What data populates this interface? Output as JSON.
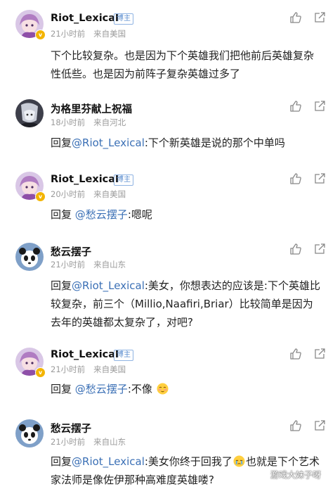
{
  "comments": [
    {
      "username": "Riot_Lexical",
      "badge": "博主",
      "time": "21小时前",
      "location": "来自美国",
      "text": "下个比较复杂。也是因为下个英雄我们把他前后英雄复杂性低些。也是因为前阵子复杂英雄过多了"
    },
    {
      "username": "为格里芬献上祝福",
      "time": "18小时前",
      "location": "来自河北",
      "reply_prefix": "回复",
      "mention": "@Riot_Lexical",
      "text": ":下个新英雄是说的那个中单吗"
    },
    {
      "username": "Riot_Lexical",
      "badge": "博主",
      "time": "20小时前",
      "location": "来自美国",
      "reply_prefix": "回复",
      "mention": "@愁云摆子",
      "text": ":嗯呢"
    },
    {
      "username": "愁云摆子",
      "time": "21小时前",
      "location": "来自山东",
      "reply_prefix": "回复",
      "mention": "@Riot_Lexical",
      "text": ":美女，你想表达的应该是:下个英雄比较复杂，前三个（Millio,Naafiri,Briar）比较简单是因为去年的英雄都太复杂了，对吧?"
    },
    {
      "username": "Riot_Lexical",
      "badge": "博主",
      "time": "21小时前",
      "location": "来自美国",
      "reply_prefix": "回复",
      "mention": "@愁云摆子",
      "text": ":不像",
      "emoji": "shy-face-emoji"
    },
    {
      "username": "愁云摆子",
      "time": "21小时前",
      "location": "来自山东",
      "reply_prefix": "回复",
      "mention": "@Riot_Lexical",
      "text_before": ":美女你终于回我了",
      "emoji": "crying-face-emoji",
      "text_after": "也就是下个艺术家法师是像佐伊那种高难度英雄喽?"
    }
  ],
  "icons": {
    "like": "thumbs-up-icon",
    "share": "share-icon"
  },
  "colors": {
    "mention": "#3a6fb5",
    "badge_border": "#8fb3e2",
    "verified": "#f3b400",
    "meta": "#9b9b9b"
  },
  "watermark": "游戏大妹子呀"
}
